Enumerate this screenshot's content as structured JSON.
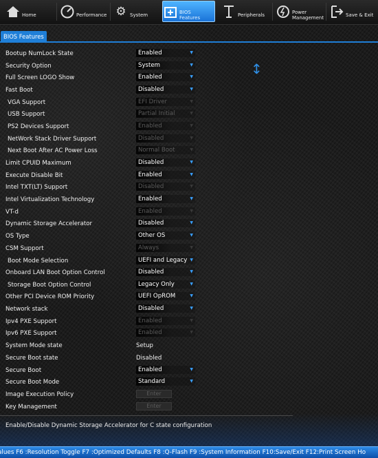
{
  "nav": [
    {
      "label": "Home",
      "icon": "home-icon"
    },
    {
      "label": "Performance",
      "icon": "performance-icon"
    },
    {
      "label": "System",
      "icon": "system-gear-icon"
    },
    {
      "label": "BIOS Features",
      "icon": "bios-features-icon"
    },
    {
      "label": "Peripherals",
      "icon": "peripherals-icon"
    },
    {
      "label": "Power Management",
      "icon": "power-icon"
    },
    {
      "label": "Save & Exit",
      "icon": "save-exit-icon"
    }
  ],
  "tab": {
    "label": "BIOS Features"
  },
  "settings": [
    {
      "name": "Bootup NumLock State",
      "value": "Enabled"
    },
    {
      "name": "Security Option",
      "value": "System"
    },
    {
      "name": "Full Screen LOGO Show",
      "value": "Enabled"
    },
    {
      "name": "Fast Boot",
      "value": "Disabled"
    },
    {
      "name": "VGA Support",
      "value": "EFI Driver"
    },
    {
      "name": "USB Support",
      "value": "Partial Initial"
    },
    {
      "name": "PS2 Devices Support",
      "value": "Enabled"
    },
    {
      "name": "NetWork Stack Driver Support",
      "value": "Disabled"
    },
    {
      "name": "Next Boot After AC Power Loss",
      "value": "Normal Boot"
    },
    {
      "name": "Limit CPUID Maximum",
      "value": "Disabled"
    },
    {
      "name": "Execute Disable Bit",
      "value": "Enabled"
    },
    {
      "name": "Intel TXT(LT) Support",
      "value": "Disabled"
    },
    {
      "name": "Intel Virtualization Technology",
      "value": "Enabled"
    },
    {
      "name": "VT-d",
      "value": "Enabled"
    },
    {
      "name": "Dynamic Storage Accelerator",
      "value": "Disabled"
    },
    {
      "name": "OS Type",
      "value": "Other OS"
    },
    {
      "name": "CSM Support",
      "value": "Always"
    },
    {
      "name": "Boot Mode Selection",
      "value": "UEFI and Legacy"
    },
    {
      "name": "Onboard LAN Boot Option Control",
      "value": "Disabled"
    },
    {
      "name": "Storage Boot Option Control",
      "value": "Legacy Only"
    },
    {
      "name": "Other PCI Device ROM Priority",
      "value": "UEFI OpROM"
    },
    {
      "name": "Network stack",
      "value": "Disabled"
    },
    {
      "name": "Ipv4 PXE Support",
      "value": "Enabled"
    },
    {
      "name": "Ipv6 PXE Support",
      "value": "Enabled"
    },
    {
      "name": "System Mode state",
      "value": "Setup"
    },
    {
      "name": "Secure Boot state",
      "value": "Disabled"
    },
    {
      "name": "Secure Boot",
      "value": "Enabled"
    },
    {
      "name": "Secure Boot Mode",
      "value": "Standard"
    },
    {
      "name": "Image Execution Policy",
      "value": "Enter"
    },
    {
      "name": "Key Management",
      "value": "Enter"
    }
  ],
  "help_text": "Enable/Disable Dynamic Storage Accelerator for C state configuration",
  "footer_text": "alues F6 :Resolution Toggle F7 :Optimized Defaults F8 :Q-Flash F9 :System Information F10:Save/Exit F12:Print Screen Ho",
  "colors": {
    "accent": "#1f7fd8",
    "arrow": "#3aa0ff"
  }
}
